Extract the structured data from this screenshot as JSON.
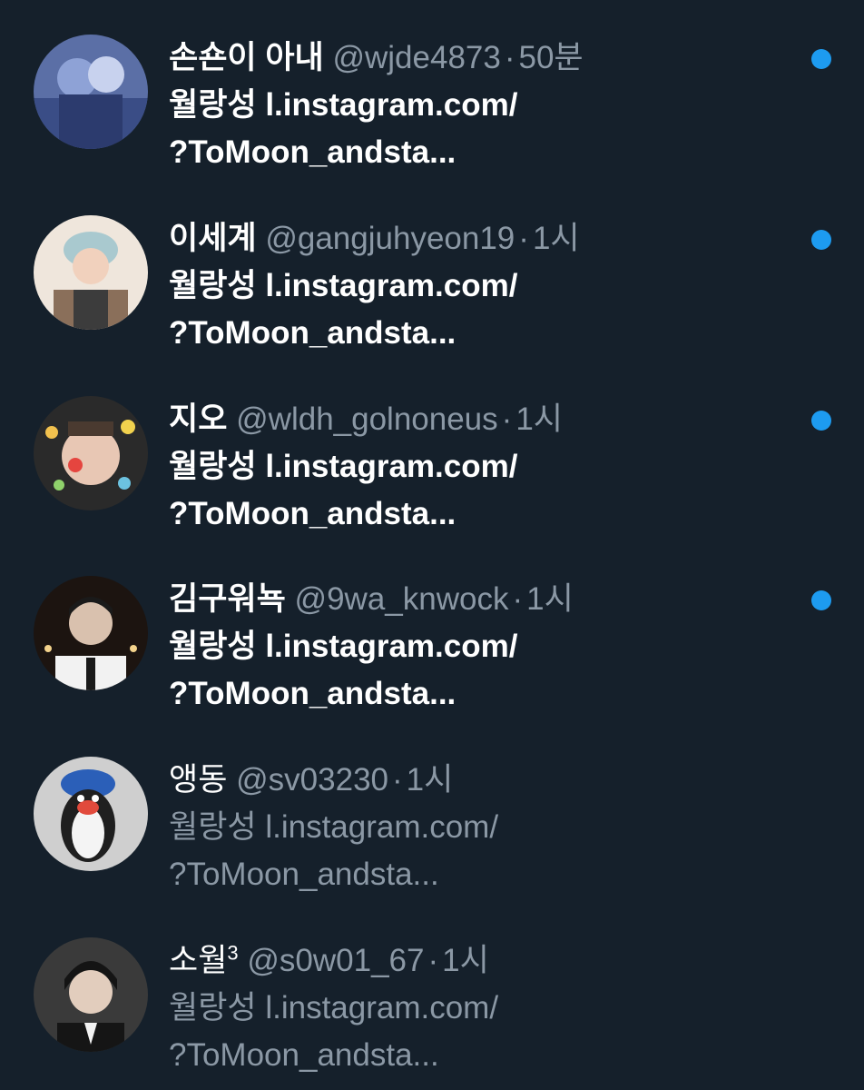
{
  "notifications": [
    {
      "display_name": "손숀이 아내",
      "handle": "@wjde4873",
      "time": "50분",
      "line1": "월랑성 l.instagram.com/",
      "line2": "?ToMoon_andsta...",
      "unread": true,
      "avatar_icon": "avatar-photo-icon"
    },
    {
      "display_name": "이세계",
      "handle": "@gangjuhyeon19",
      "time": "1시",
      "line1": "월랑성 l.instagram.com/",
      "line2": "?ToMoon_andsta...",
      "unread": true,
      "avatar_icon": "avatar-photo-icon"
    },
    {
      "display_name": "지오",
      "handle": "@wldh_golnoneus",
      "time": "1시",
      "line1": "월랑성 l.instagram.com/",
      "line2": "?ToMoon_andsta...",
      "unread": true,
      "avatar_icon": "avatar-photo-icon"
    },
    {
      "display_name": "김구워뇩",
      "handle": "@9wa_knwock",
      "time": "1시",
      "line1": "월랑성 l.instagram.com/",
      "line2": "?ToMoon_andsta...",
      "unread": true,
      "avatar_icon": "avatar-photo-icon"
    },
    {
      "display_name": "앵동",
      "handle": "@sv03230",
      "time": "1시",
      "line1": "월랑성 l.instagram.com/",
      "line2": "?ToMoon_andsta...",
      "unread": false,
      "avatar_icon": "avatar-photo-icon"
    },
    {
      "display_name": "소월",
      "name_superscript": "3",
      "handle": "@s0w01_67",
      "time": "1시",
      "line1": "월랑성 l.instagram.com/",
      "line2": "?ToMoon_andsta...",
      "unread": false,
      "avatar_icon": "avatar-photo-icon"
    }
  ],
  "separator": "·",
  "colors": {
    "background": "#15202b",
    "text_primary": "#ffffff",
    "text_secondary": "#8b98a5",
    "unread_dot": "#1d9bf0"
  }
}
